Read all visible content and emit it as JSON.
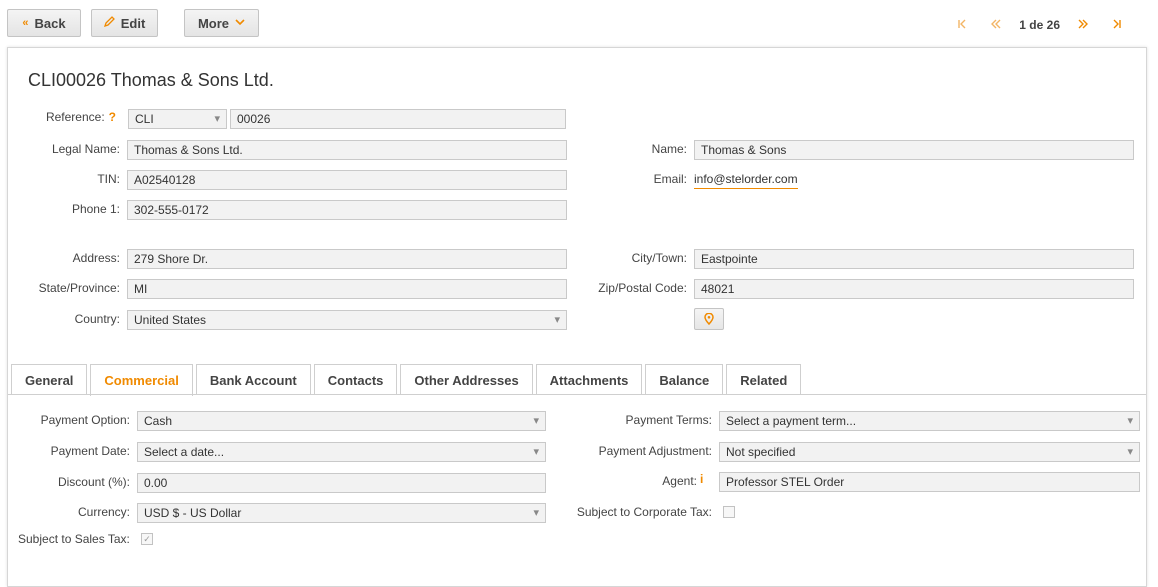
{
  "toolbar": {
    "back_label": "Back",
    "edit_label": "Edit",
    "more_label": "More"
  },
  "pager": {
    "first_icon": "«",
    "prev_icon": "‹",
    "current": "1 de 26",
    "next_icon": "›",
    "last_icon": "»"
  },
  "record": {
    "title": "CLI00026 Thomas & Sons Ltd."
  },
  "form": {
    "reference_label": "Reference:",
    "reference_prefix": "CLI",
    "reference_number": "00026",
    "legal_name_label": "Legal Name:",
    "legal_name": "Thomas & Sons Ltd.",
    "tin_label": "TIN:",
    "tin": "A02540128",
    "phone1_label": "Phone 1:",
    "phone1": "302-555-0172",
    "name_label": "Name:",
    "name": "Thomas & Sons",
    "email_label": "Email:",
    "email": "info@stelorder.com",
    "address_label": "Address:",
    "address": "279 Shore Dr.",
    "state_label": "State/Province:",
    "state": "MI",
    "country_label": "Country:",
    "country": "United States",
    "city_label": "City/Town:",
    "city": "Eastpointe",
    "zip_label": "Zip/Postal Code:",
    "zip": "48021"
  },
  "tabs": [
    {
      "label": "General"
    },
    {
      "label": "Commercial"
    },
    {
      "label": "Bank Account"
    },
    {
      "label": "Contacts"
    },
    {
      "label": "Other Addresses"
    },
    {
      "label": "Attachments"
    },
    {
      "label": "Balance"
    },
    {
      "label": "Related"
    }
  ],
  "commercial": {
    "payment_option_label": "Payment Option:",
    "payment_option": "Cash",
    "payment_date_label": "Payment Date:",
    "payment_date_placeholder": "Select a date...",
    "discount_label": "Discount (%):",
    "discount": "0.00",
    "currency_label": "Currency:",
    "currency": "USD $ - US Dollar",
    "sales_tax_label": "Subject to Sales Tax:",
    "payment_terms_label": "Payment Terms:",
    "payment_terms_placeholder": "Select a payment term...",
    "payment_adjustment_label": "Payment Adjustment:",
    "payment_adjustment": "Not specified",
    "agent_label": "Agent:",
    "agent": "Professor STEL Order",
    "corporate_tax_label": "Subject to Corporate Tax:"
  },
  "colors": {
    "accent": "#f08a00"
  }
}
